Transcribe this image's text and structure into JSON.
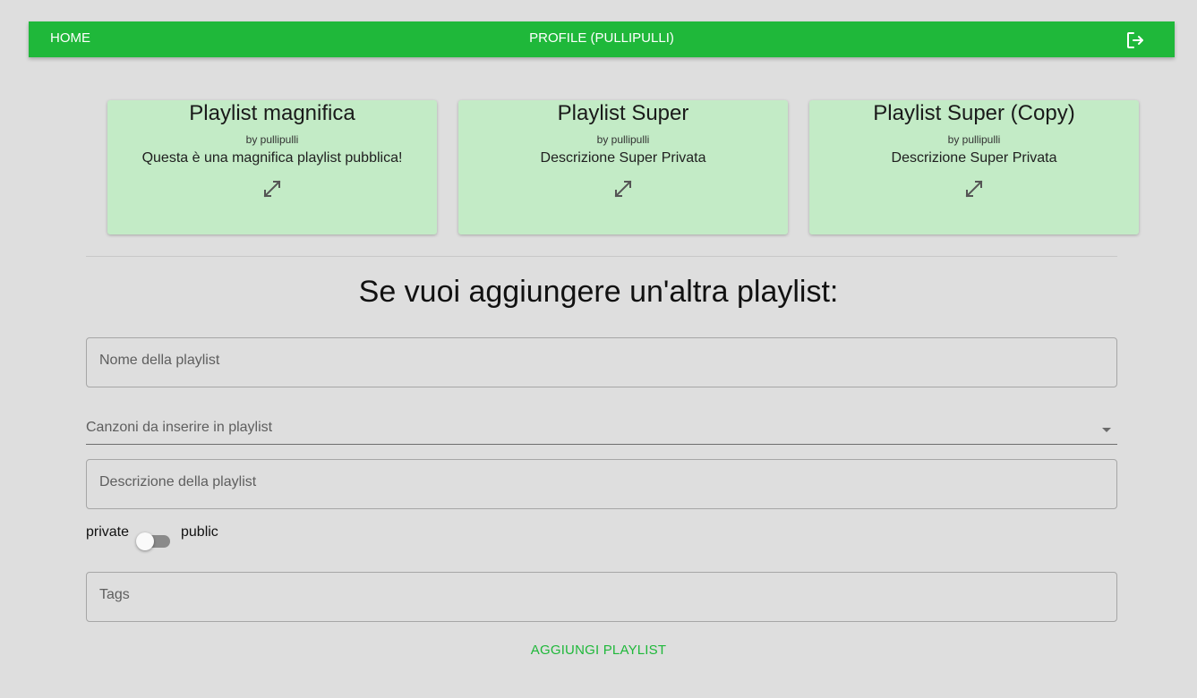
{
  "navbar": {
    "home_label": "HOME",
    "profile_label": "PROFILE (PULLIPULLI)",
    "logout_icon": "logout-icon",
    "bg_color": "#1fb83a"
  },
  "playlists": [
    {
      "title": "Playlist magnifica",
      "author": "by pullipulli",
      "description": "Questa è una magnifica playlist pubblica!",
      "icon": "expand-icon"
    },
    {
      "title": "Playlist Super",
      "author": "by pullipulli",
      "description": "Descrizione Super Privata",
      "icon": "expand-icon"
    },
    {
      "title": "Playlist Super (Copy)",
      "author": "by pullipulli",
      "description": "Descrizione Super Privata",
      "icon": "expand-icon"
    }
  ],
  "form": {
    "title": "Se vuoi aggiungere un'altra playlist:",
    "name_placeholder": "Nome della playlist",
    "songs_label": "Canzoni da inserire in playlist",
    "description_placeholder": "Descrizione della playlist",
    "visibility": {
      "off_label": "private",
      "on_label": "public",
      "is_public": false
    },
    "tags_placeholder": "Tags",
    "submit_label": "AGGIUNGI PLAYLIST"
  },
  "colors": {
    "accent": "#1fb83a",
    "card_bg": "#c3ebc6",
    "page_bg": "#dedede"
  }
}
